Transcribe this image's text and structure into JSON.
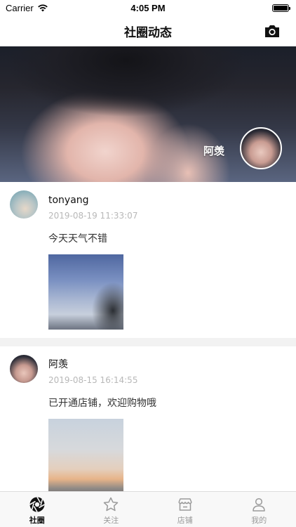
{
  "status_bar": {
    "carrier": "Carrier",
    "time": "4:05 PM"
  },
  "nav": {
    "title": "社圈动态",
    "camera_icon": "camera-icon"
  },
  "banner": {
    "name": "阿羡"
  },
  "posts": [
    {
      "user": "tonyang",
      "time": "2019-08-19 11:33:07",
      "text": "今天天气不错"
    },
    {
      "user": "阿羡",
      "time": "2019-08-15 16:14:55",
      "text": "已开通店铺，欢迎购物哦"
    }
  ],
  "tabs": [
    {
      "label": "社圈",
      "icon": "aperture-icon",
      "active": true
    },
    {
      "label": "关注",
      "icon": "star-icon",
      "active": false
    },
    {
      "label": "店铺",
      "icon": "store-icon",
      "active": false
    },
    {
      "label": "我的",
      "icon": "user-icon",
      "active": false
    }
  ],
  "colors": {
    "accent": "#111111",
    "inactive": "#9a9a9a",
    "timestamp": "#b8b8b8"
  }
}
